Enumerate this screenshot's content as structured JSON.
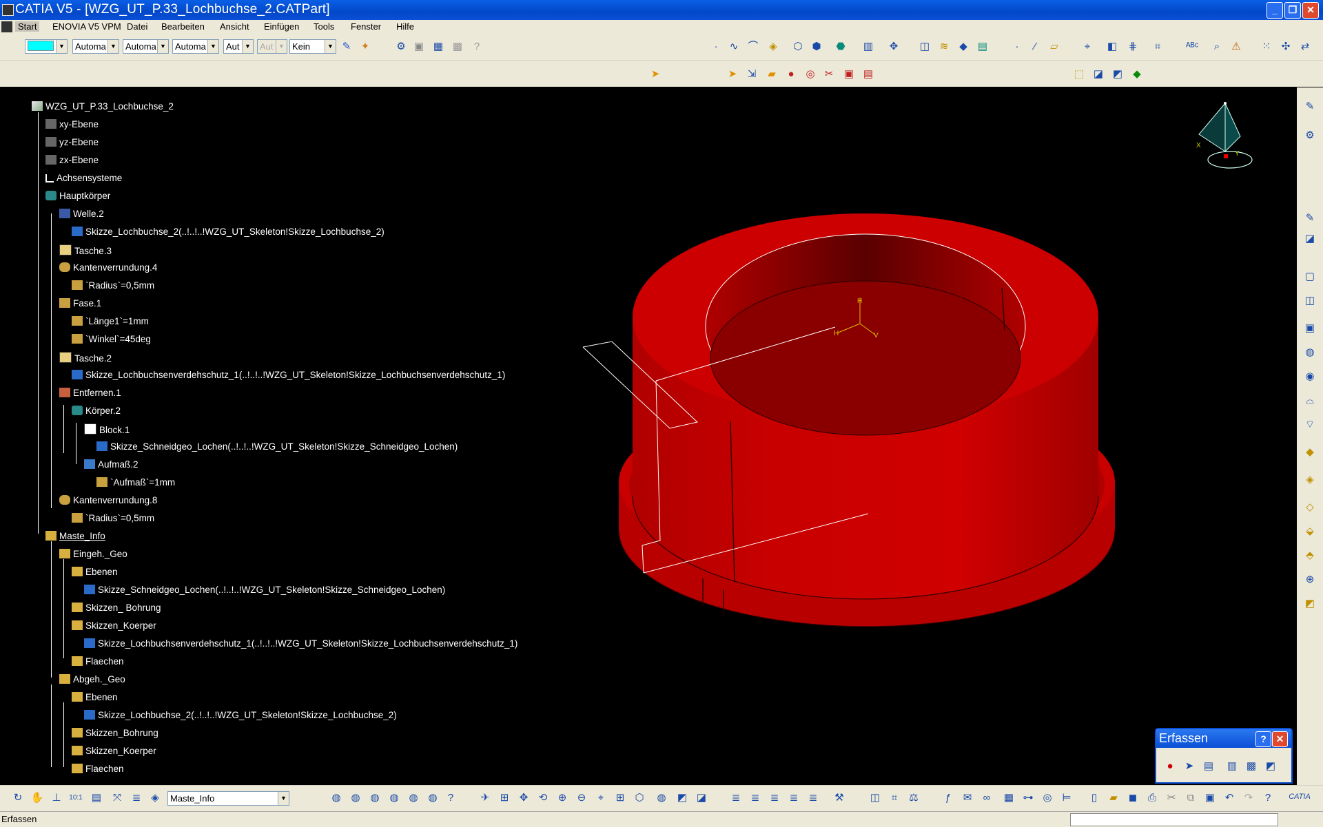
{
  "window": {
    "title": "CATIA V5 - [WZG_UT_P.33_Lochbuchse_2.CATPart]",
    "min_icon": "minimize-icon",
    "max_icon": "restore-icon",
    "close_icon": "close-icon"
  },
  "menu": [
    "Start",
    "ENOVIA V5 VPM",
    "Datei",
    "Bearbeiten",
    "Ansicht",
    "Einfügen",
    "Tools",
    "Fenster",
    "Hilfe"
  ],
  "toolbar": {
    "color_combo": "",
    "combo2": "Automa",
    "combo3": "Automa",
    "combo4": "Automa",
    "combo5": "Aut",
    "combo6": "Aut",
    "combo7": "Kein"
  },
  "tree": [
    {
      "label": "WZG_UT_P.33_Lochbuchse_2",
      "icon": "part-icon"
    },
    {
      "label": "xy-Ebene",
      "icon": "plane-icon"
    },
    {
      "label": "yz-Ebene",
      "icon": "plane-icon"
    },
    {
      "label": "zx-Ebene",
      "icon": "plane-icon"
    },
    {
      "label": "Achsensysteme",
      "icon": "axis-icon"
    },
    {
      "label": "Hauptkörper",
      "icon": "body-icon"
    },
    {
      "label": "Welle.2",
      "icon": "shaft-icon"
    },
    {
      "label": "Skizze_Lochbuchse_2(..!..!..!WZG_UT_Skeleton!Skizze_Lochbuchse_2)",
      "icon": "sketch-icon"
    },
    {
      "label": "Tasche.3",
      "icon": "pocket-icon"
    },
    {
      "label": "Kantenverrundung.4",
      "icon": "fillet-icon"
    },
    {
      "label": "`Radius`=0,5mm",
      "icon": "parameter-icon"
    },
    {
      "label": "Fase.1",
      "icon": "chamfer-icon"
    },
    {
      "label": "`Länge1`=1mm",
      "icon": "parameter-icon"
    },
    {
      "label": "`Winkel`=45deg",
      "icon": "parameter-icon"
    },
    {
      "label": "Tasche.2",
      "icon": "pocket-icon"
    },
    {
      "label": "Skizze_Lochbuchsenverdehschutz_1(..!..!..!WZG_UT_Skeleton!Skizze_Lochbuchsenverdehschutz_1)",
      "icon": "sketch-icon"
    },
    {
      "label": "Entfernen.1",
      "icon": "remove-icon"
    },
    {
      "label": "Körper.2",
      "icon": "body-icon"
    },
    {
      "label": "Block.1",
      "icon": "pad-icon"
    },
    {
      "label": "Skizze_Schneidgeo_Lochen(..!..!..!WZG_UT_Skeleton!Skizze_Schneidgeo_Lochen)",
      "icon": "sketch-icon"
    },
    {
      "label": "Aufmaß.2",
      "icon": "thickness-icon"
    },
    {
      "label": "`Aufmaß`=1mm",
      "icon": "parameter-icon"
    },
    {
      "label": "Kantenverrundung.8",
      "icon": "fillet-icon"
    },
    {
      "label": "`Radius`=0,5mm",
      "icon": "parameter-icon"
    },
    {
      "label": "Maste_Info",
      "icon": "geoset-icon"
    },
    {
      "label": "Eingeh._Geo",
      "icon": "geoset-icon"
    },
    {
      "label": "Ebenen",
      "icon": "geoset-icon"
    },
    {
      "label": "Skizze_Schneidgeo_Lochen(..!..!..!WZG_UT_Skeleton!Skizze_Schneidgeo_Lochen)",
      "icon": "sketch-icon"
    },
    {
      "label": "Skizzen_ Bohrung",
      "icon": "geoset-icon"
    },
    {
      "label": "Skizzen_Koerper",
      "icon": "geoset-icon"
    },
    {
      "label": "Skizze_Lochbuchsenverdehschutz_1(..!..!..!WZG_UT_Skeleton!Skizze_Lochbuchsenverdehschutz_1)",
      "icon": "sketch-icon"
    },
    {
      "label": "Flaechen",
      "icon": "geoset-icon"
    },
    {
      "label": "Abgeh._Geo",
      "icon": "geoset-icon"
    },
    {
      "label": "Ebenen",
      "icon": "geoset-icon"
    },
    {
      "label": "Skizze_Lochbuchse_2(..!..!..!WZG_UT_Skeleton!Skizze_Lochbuchse_2)",
      "icon": "sketch-icon"
    },
    {
      "label": "Skizzen_Bohrung",
      "icon": "geoset-icon"
    },
    {
      "label": "Skizzen_Koerper",
      "icon": "geoset-icon"
    },
    {
      "label": "Flaechen",
      "icon": "geoset-icon"
    }
  ],
  "viewport": {
    "model_color": "#c00000",
    "compass_label_x": "X",
    "compass_label_y": "Y"
  },
  "bottom_toolbar": {
    "current_set": "Maste_Info"
  },
  "erfassen": {
    "title": "Erfassen",
    "help_label": "?",
    "close_icon": "close-icon"
  },
  "status": {
    "text": "Erfassen",
    "input": ""
  }
}
